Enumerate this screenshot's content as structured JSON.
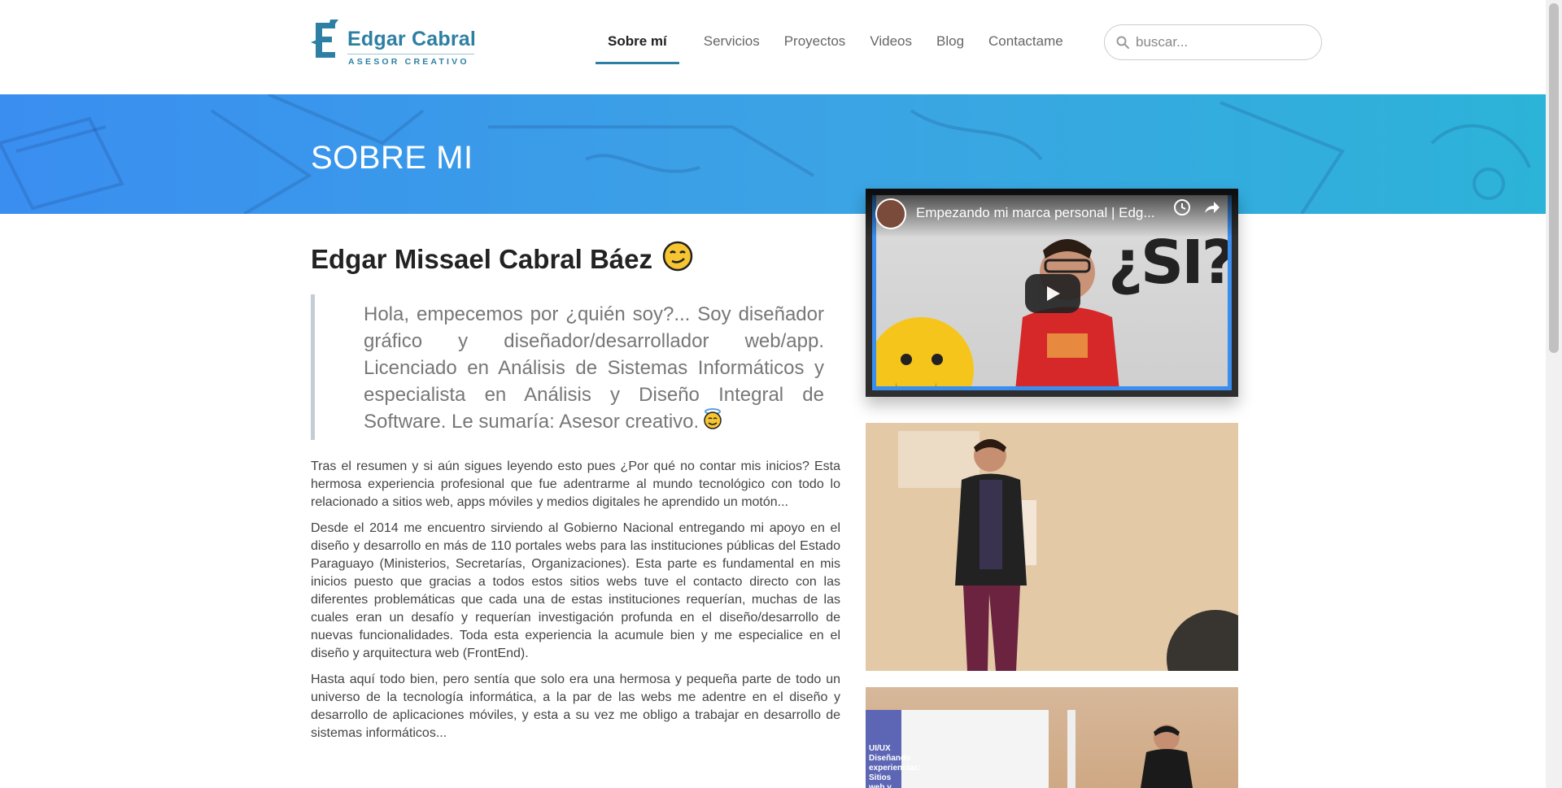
{
  "header": {
    "logo": {
      "name": "Edgar Cabral",
      "tagline": "ASESOR CREATIVO"
    },
    "nav": [
      {
        "label": "Sobre mí",
        "active": true
      },
      {
        "label": "Servicios",
        "active": false
      },
      {
        "label": "Proyectos",
        "active": false
      },
      {
        "label": "Videos",
        "active": false
      },
      {
        "label": "Blog",
        "active": false
      },
      {
        "label": "Contactame",
        "active": false
      }
    ],
    "search": {
      "placeholder": "buscar...",
      "value": ""
    }
  },
  "banner": {
    "title": "SOBRE MI"
  },
  "main": {
    "name": "Edgar Missael Cabral Báez",
    "name_emoji": "😏",
    "quote": "Hola, empecemos por ¿quién soy?... Soy diseñador gráfico y diseñador/desarrollador web/app. Licenciado en Análisis de Sistemas Informáticos y especialista en Análisis y Diseño Integral de Software. Le sumaría: Asesor creativo.",
    "quote_emoji": "😇",
    "paragraphs": [
      "Tras el resumen y si aún sigues leyendo esto pues ¿Por qué no contar mis inicios? Esta hermosa experiencia profesional que fue adentrarme al mundo tecnológico con todo lo relacionado a sitios web, apps móviles y medios digitales he aprendido un motón...",
      "Desde el 2014 me encuentro sirviendo al Gobierno Nacional entregando mi apoyo en el diseño y desarrollo en más de 110 portales webs para las instituciones públicas del Estado Paraguayo (Ministerios, Secretarías, Organizaciones). Esta parte es fundamental en mis inicios puesto que gracias a todos estos sitios webs tuve el contacto directo con las diferentes problemáticas que cada una de estas instituciones requerían, muchas de las cuales eran un desafío y requerían investigación profunda en el diseño/desarrollo de nuevas funcionalidades. Toda esta experiencia la acumule bien y me especialice en el diseño y arquitectura web (FrontEnd).",
      "Hasta aquí todo bien, pero sentía que solo era una hermosa y pequeña parte de todo un universo de la tecnología informática, a la par de las webs me adentre en el diseño y desarrollo de aplicaciones móviles, y esta a su vez me obligo a trabajar en desarrollo de sistemas informáticos..."
    ]
  },
  "video": {
    "title": "Empezando mi marca personal | Edg...",
    "thumbnail_text": "¿SI?"
  },
  "photo2": {
    "slide_text": "UI/UX Diseñando experiencias: Sitios web y"
  },
  "colors": {
    "accent": "#2d7fa3",
    "banner_start": "#3a8ef0",
    "banner_end": "#2cb3d8"
  }
}
